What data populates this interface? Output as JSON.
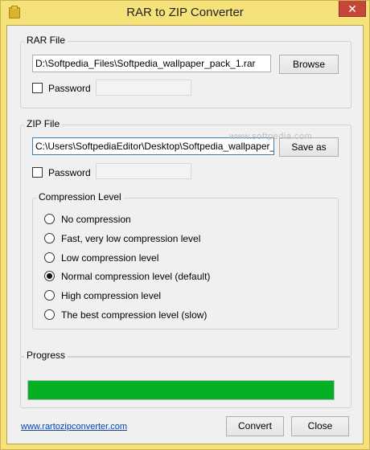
{
  "window": {
    "title": "RAR to ZIP Converter",
    "close_glyph": "✕",
    "accent_color": "#f6e27a"
  },
  "rar_group": {
    "label": "RAR File",
    "path_value": "D:\\Softpedia_Files\\Softpedia_wallpaper_pack_1.rar",
    "browse_label": "Browse",
    "password_label": "Password",
    "password_checked": false,
    "password_value": ""
  },
  "zip_group": {
    "label": "ZIP File",
    "path_value": "C:\\Users\\SoftpediaEditor\\Desktop\\Softpedia_wallpaper_pack",
    "save_label": "Save as",
    "password_label": "Password",
    "password_checked": false,
    "password_value": ""
  },
  "compression": {
    "label": "Compression Level",
    "options": [
      {
        "label": "No compression",
        "checked": false
      },
      {
        "label": "Fast, very low compression level",
        "checked": false
      },
      {
        "label": "Low compression level",
        "checked": false
      },
      {
        "label": "Normal compression level (default)",
        "checked": true
      },
      {
        "label": "High compression level",
        "checked": false
      },
      {
        "label": "The best compression level (slow)",
        "checked": false
      }
    ]
  },
  "progress": {
    "label": "Progress",
    "percent": 100,
    "color": "#06b025"
  },
  "footer": {
    "link_text": "www.rartozipconverter.com",
    "convert_label": "Convert",
    "close_label": "Close"
  },
  "watermark": "www.softpedia.com",
  "icons": {
    "app": "folder-icon",
    "close": "close-icon"
  }
}
